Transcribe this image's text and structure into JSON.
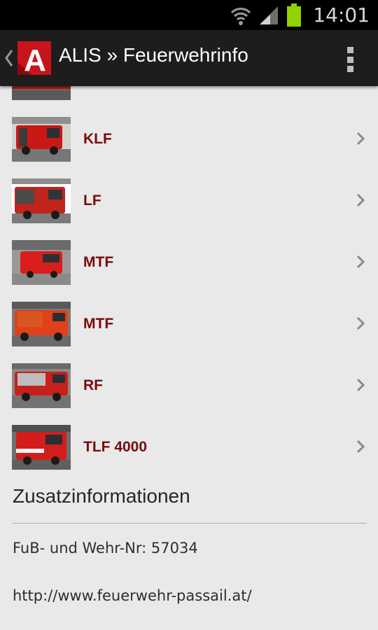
{
  "status_bar": {
    "time": "14:01"
  },
  "action_bar": {
    "title": "ALIS » Feuerwehrinfo",
    "logo_letter": "A"
  },
  "vehicles": [
    {
      "label": ""
    },
    {
      "label": "KLF"
    },
    {
      "label": "LF"
    },
    {
      "label": "MTF"
    },
    {
      "label": "MTF"
    },
    {
      "label": "RF"
    },
    {
      "label": "TLF 4000"
    }
  ],
  "section": {
    "title": "Zusatzinformationen"
  },
  "info": {
    "number": "FuB- und Wehr-Nr: 57034",
    "url": "http://www.feuerwehr-passail.at/"
  },
  "colors": {
    "accent": "#7a0b0b",
    "logo_red": "#c8141b",
    "action_bar": "#1d1d1d"
  }
}
